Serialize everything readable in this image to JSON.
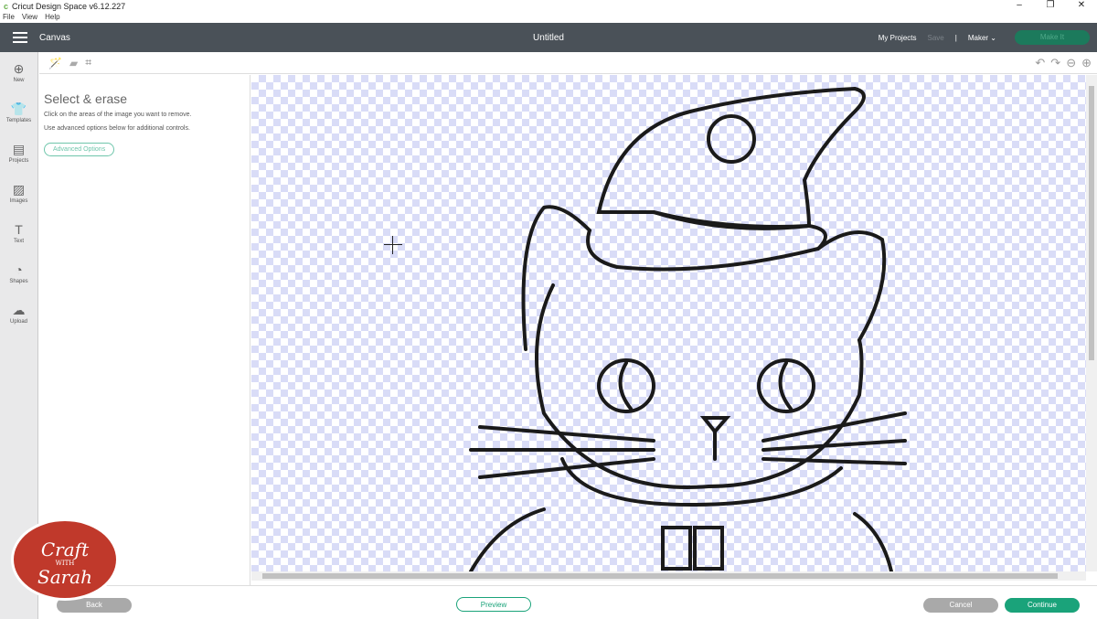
{
  "window": {
    "title": "Cricut Design Space  v6.12.227",
    "controls": [
      "–",
      "❐",
      "✕"
    ]
  },
  "menu": [
    "File",
    "View",
    "Help"
  ],
  "header": {
    "section": "Canvas",
    "doc_title": "Untitled",
    "my_projects": "My Projects",
    "save": "Save",
    "separator": "|",
    "machine": "Maker",
    "make_it": "Make It"
  },
  "sidebar": [
    {
      "label": "New",
      "icon": "⊕"
    },
    {
      "label": "Templates",
      "icon": "👕"
    },
    {
      "label": "Projects",
      "icon": "▤"
    },
    {
      "label": "Images",
      "icon": "▨"
    },
    {
      "label": "Text",
      "icon": "T"
    },
    {
      "label": "Shapes",
      "icon": "◔"
    },
    {
      "label": "Upload",
      "icon": "☁"
    }
  ],
  "panel": {
    "title": "Select & erase",
    "line1": "Click on the areas of the image you want to remove.",
    "line2": "Use advanced options below for additional controls.",
    "advanced": "Advanced Options"
  },
  "footer": {
    "back": "Back",
    "preview": "Preview",
    "cancel": "Cancel",
    "continue": "Continue"
  },
  "brand": {
    "line1": "Craft",
    "with": "WITH",
    "line2": "Sarah"
  },
  "colors": {
    "header": "#4a5158",
    "accent": "#1aa37a"
  }
}
